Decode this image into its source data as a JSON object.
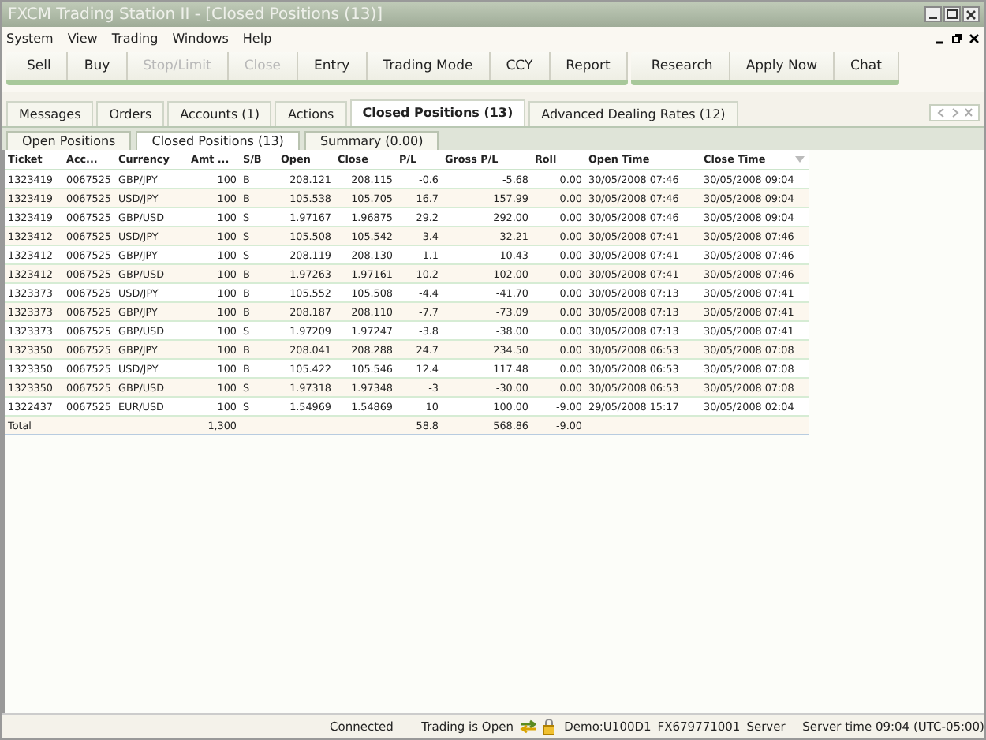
{
  "window": {
    "title": "FXCM Trading Station II - [Closed Positions (13)]"
  },
  "menu": [
    "System",
    "View",
    "Trading",
    "Windows",
    "Help"
  ],
  "toolbar": [
    [
      {
        "label": "Sell",
        "disabled": false
      },
      {
        "label": "Buy",
        "disabled": false
      },
      {
        "label": "Stop/Limit",
        "disabled": true
      },
      {
        "label": "Close",
        "disabled": true
      },
      {
        "label": "Entry",
        "disabled": false
      },
      {
        "label": "Trading Mode",
        "disabled": false
      },
      {
        "label": "CCY",
        "disabled": false
      },
      {
        "label": "Report",
        "disabled": false
      }
    ],
    [
      {
        "label": "Research",
        "disabled": false
      },
      {
        "label": "Apply Now",
        "disabled": false
      },
      {
        "label": "Chat",
        "disabled": false
      }
    ]
  ],
  "tabs": [
    {
      "label": "Messages",
      "selected": false
    },
    {
      "label": "Orders",
      "selected": false
    },
    {
      "label": "Accounts (1)",
      "selected": false
    },
    {
      "label": "Actions",
      "selected": false
    },
    {
      "label": "Closed Positions (13)",
      "selected": true
    },
    {
      "label": "Advanced Dealing Rates (12)",
      "selected": false
    }
  ],
  "subtabs": [
    {
      "label": "Open Positions",
      "selected": false
    },
    {
      "label": "Closed Positions (13)",
      "selected": true
    },
    {
      "label": "Summary (0.00)",
      "selected": false
    }
  ],
  "table": {
    "columns": [
      {
        "label": "Ticket",
        "sorted": false
      },
      {
        "label": "Acc...",
        "sorted": false
      },
      {
        "label": "Currency",
        "sorted": false
      },
      {
        "label": "Amt ...",
        "sorted": false
      },
      {
        "label": "S/B",
        "sorted": false
      },
      {
        "label": "Open",
        "sorted": false
      },
      {
        "label": "Close",
        "sorted": false
      },
      {
        "label": "P/L",
        "sorted": false
      },
      {
        "label": "Gross P/L",
        "sorted": false
      },
      {
        "label": "Roll",
        "sorted": false
      },
      {
        "label": "Open Time",
        "sorted": false
      },
      {
        "label": "Close Time",
        "sorted": true
      }
    ],
    "rows": [
      [
        "1323419",
        "0067525",
        "GBP/JPY",
        "100",
        "B",
        "208.121",
        "208.115",
        "-0.6",
        "-5.68",
        "0.00",
        "30/05/2008 07:46",
        "30/05/2008 09:04"
      ],
      [
        "1323419",
        "0067525",
        "USD/JPY",
        "100",
        "B",
        "105.538",
        "105.705",
        "16.7",
        "157.99",
        "0.00",
        "30/05/2008 07:46",
        "30/05/2008 09:04"
      ],
      [
        "1323419",
        "0067525",
        "GBP/USD",
        "100",
        "S",
        "1.97167",
        "1.96875",
        "29.2",
        "292.00",
        "0.00",
        "30/05/2008 07:46",
        "30/05/2008 09:04"
      ],
      [
        "1323412",
        "0067525",
        "USD/JPY",
        "100",
        "S",
        "105.508",
        "105.542",
        "-3.4",
        "-32.21",
        "0.00",
        "30/05/2008 07:41",
        "30/05/2008 07:46"
      ],
      [
        "1323412",
        "0067525",
        "GBP/JPY",
        "100",
        "S",
        "208.119",
        "208.130",
        "-1.1",
        "-10.43",
        "0.00",
        "30/05/2008 07:41",
        "30/05/2008 07:46"
      ],
      [
        "1323412",
        "0067525",
        "GBP/USD",
        "100",
        "B",
        "1.97263",
        "1.97161",
        "-10.2",
        "-102.00",
        "0.00",
        "30/05/2008 07:41",
        "30/05/2008 07:46"
      ],
      [
        "1323373",
        "0067525",
        "USD/JPY",
        "100",
        "B",
        "105.552",
        "105.508",
        "-4.4",
        "-41.70",
        "0.00",
        "30/05/2008 07:13",
        "30/05/2008 07:41"
      ],
      [
        "1323373",
        "0067525",
        "GBP/JPY",
        "100",
        "B",
        "208.187",
        "208.110",
        "-7.7",
        "-73.09",
        "0.00",
        "30/05/2008 07:13",
        "30/05/2008 07:41"
      ],
      [
        "1323373",
        "0067525",
        "GBP/USD",
        "100",
        "S",
        "1.97209",
        "1.97247",
        "-3.8",
        "-38.00",
        "0.00",
        "30/05/2008 07:13",
        "30/05/2008 07:41"
      ],
      [
        "1323350",
        "0067525",
        "GBP/JPY",
        "100",
        "B",
        "208.041",
        "208.288",
        "24.7",
        "234.50",
        "0.00",
        "30/05/2008 06:53",
        "30/05/2008 07:08"
      ],
      [
        "1323350",
        "0067525",
        "USD/JPY",
        "100",
        "B",
        "105.422",
        "105.546",
        "12.4",
        "117.48",
        "0.00",
        "30/05/2008 06:53",
        "30/05/2008 07:08"
      ],
      [
        "1323350",
        "0067525",
        "GBP/USD",
        "100",
        "S",
        "1.97318",
        "1.97348",
        "-3",
        "-30.00",
        "0.00",
        "30/05/2008 06:53",
        "30/05/2008 07:08"
      ],
      [
        "1322437",
        "0067525",
        "EUR/USD",
        "100",
        "S",
        "1.54969",
        "1.54869",
        "10",
        "100.00",
        "-9.00",
        "29/05/2008 15:17",
        "30/05/2008 02:04"
      ]
    ],
    "total": {
      "label": "Total",
      "amount": "1,300",
      "pl": "58.8",
      "gross_pl": "568.86",
      "roll": "-9.00"
    }
  },
  "status_bar": {
    "connection": "Connected",
    "trading": "Trading is Open",
    "account": "Demo:U100D1",
    "login": "FX679771001",
    "server": "Server",
    "server_time": "Server time 09:04 (UTC-05:00)"
  }
}
